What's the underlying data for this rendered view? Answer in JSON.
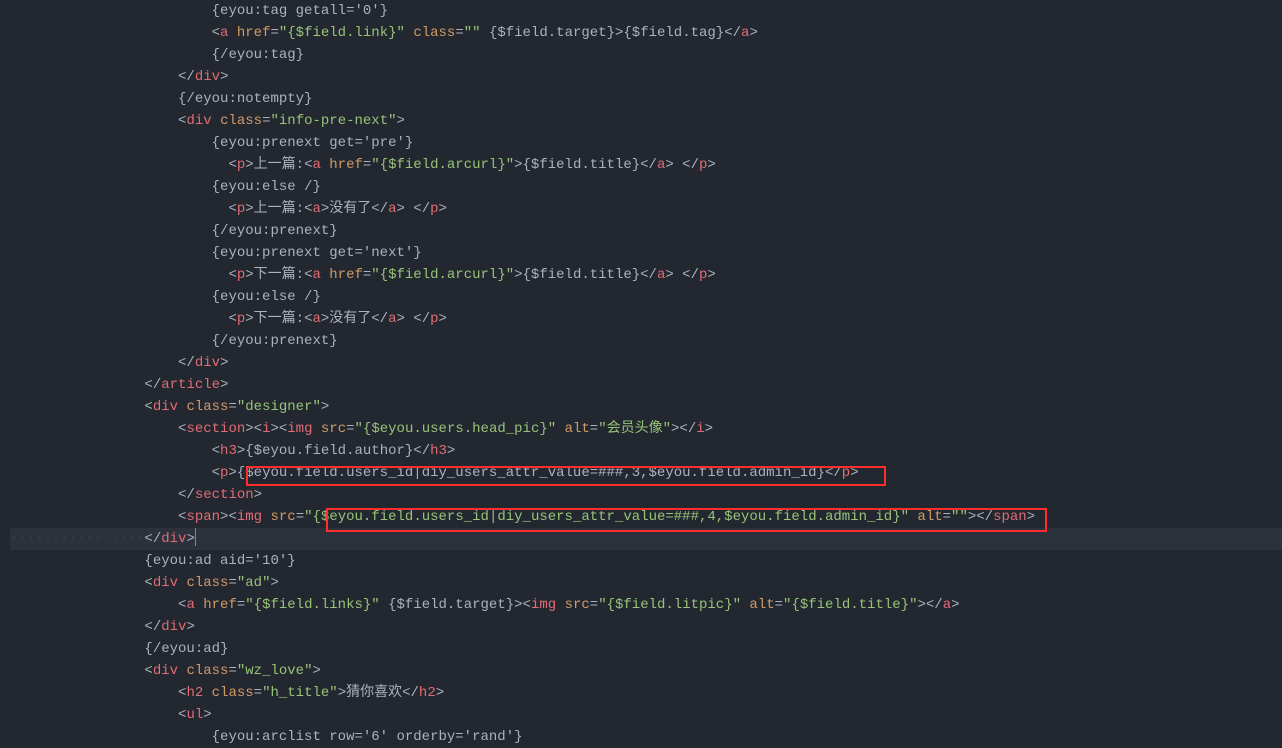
{
  "lines": [
    {
      "indent": 24,
      "segs": [
        {
          "c": "tx",
          "t": "{eyou:tag getall='0'}"
        }
      ]
    },
    {
      "indent": 24,
      "segs": [
        {
          "c": "b",
          "t": "<"
        },
        {
          "c": "t",
          "t": "a"
        },
        {
          "c": "b",
          "t": " "
        },
        {
          "c": "a",
          "t": "href"
        },
        {
          "c": "b",
          "t": "="
        },
        {
          "c": "s",
          "t": "\"{$field.link}\""
        },
        {
          "c": "b",
          "t": " "
        },
        {
          "c": "a",
          "t": "class"
        },
        {
          "c": "b",
          "t": "="
        },
        {
          "c": "s",
          "t": "\"\""
        },
        {
          "c": "b",
          "t": " "
        },
        {
          "c": "tx",
          "t": "{$field.target}"
        },
        {
          "c": "b",
          "t": ">"
        },
        {
          "c": "tx",
          "t": "{$field.tag}"
        },
        {
          "c": "b",
          "t": "</"
        },
        {
          "c": "t",
          "t": "a"
        },
        {
          "c": "b",
          "t": ">"
        }
      ]
    },
    {
      "indent": 24,
      "segs": [
        {
          "c": "tx",
          "t": "{/eyou:tag}"
        }
      ]
    },
    {
      "indent": 20,
      "segs": [
        {
          "c": "b",
          "t": "</"
        },
        {
          "c": "t",
          "t": "div"
        },
        {
          "c": "b",
          "t": ">"
        }
      ]
    },
    {
      "indent": 20,
      "segs": [
        {
          "c": "tx",
          "t": "{/eyou:notempty}"
        }
      ]
    },
    {
      "indent": 20,
      "segs": [
        {
          "c": "b",
          "t": "<"
        },
        {
          "c": "t",
          "t": "div"
        },
        {
          "c": "b",
          "t": " "
        },
        {
          "c": "a",
          "t": "class"
        },
        {
          "c": "b",
          "t": "="
        },
        {
          "c": "s",
          "t": "\"info-pre-next\""
        },
        {
          "c": "b",
          "t": ">"
        }
      ]
    },
    {
      "indent": 24,
      "segs": [
        {
          "c": "tx",
          "t": "{eyou:prenext get='pre'}"
        }
      ]
    },
    {
      "indent": 26,
      "segs": [
        {
          "c": "b",
          "t": "<"
        },
        {
          "c": "t",
          "t": "p"
        },
        {
          "c": "b",
          "t": ">"
        },
        {
          "c": "tx",
          "t": "上一篇:"
        },
        {
          "c": "b",
          "t": "<"
        },
        {
          "c": "t",
          "t": "a"
        },
        {
          "c": "b",
          "t": " "
        },
        {
          "c": "a",
          "t": "href"
        },
        {
          "c": "b",
          "t": "="
        },
        {
          "c": "s",
          "t": "\"{$field.arcurl}\""
        },
        {
          "c": "b",
          "t": ">"
        },
        {
          "c": "tx",
          "t": "{$field.title}"
        },
        {
          "c": "b",
          "t": "</"
        },
        {
          "c": "t",
          "t": "a"
        },
        {
          "c": "b",
          "t": "> </"
        },
        {
          "c": "t",
          "t": "p"
        },
        {
          "c": "b",
          "t": ">"
        }
      ]
    },
    {
      "indent": 24,
      "segs": [
        {
          "c": "tx",
          "t": "{eyou:else /}"
        }
      ]
    },
    {
      "indent": 26,
      "segs": [
        {
          "c": "b",
          "t": "<"
        },
        {
          "c": "t",
          "t": "p"
        },
        {
          "c": "b",
          "t": ">"
        },
        {
          "c": "tx",
          "t": "上一篇:"
        },
        {
          "c": "b",
          "t": "<"
        },
        {
          "c": "t",
          "t": "a"
        },
        {
          "c": "b",
          "t": ">"
        },
        {
          "c": "tx",
          "t": "没有了"
        },
        {
          "c": "b",
          "t": "</"
        },
        {
          "c": "t",
          "t": "a"
        },
        {
          "c": "b",
          "t": "> </"
        },
        {
          "c": "t",
          "t": "p"
        },
        {
          "c": "b",
          "t": ">"
        }
      ]
    },
    {
      "indent": 24,
      "segs": [
        {
          "c": "tx",
          "t": "{/eyou:prenext}"
        }
      ]
    },
    {
      "indent": 24,
      "segs": [
        {
          "c": "tx",
          "t": "{eyou:prenext get='next'}"
        }
      ]
    },
    {
      "indent": 26,
      "segs": [
        {
          "c": "b",
          "t": "<"
        },
        {
          "c": "t",
          "t": "p"
        },
        {
          "c": "b",
          "t": ">"
        },
        {
          "c": "tx",
          "t": "下一篇:"
        },
        {
          "c": "b",
          "t": "<"
        },
        {
          "c": "t",
          "t": "a"
        },
        {
          "c": "b",
          "t": " "
        },
        {
          "c": "a",
          "t": "href"
        },
        {
          "c": "b",
          "t": "="
        },
        {
          "c": "s",
          "t": "\"{$field.arcurl}\""
        },
        {
          "c": "b",
          "t": ">"
        },
        {
          "c": "tx",
          "t": "{$field.title}"
        },
        {
          "c": "b",
          "t": "</"
        },
        {
          "c": "t",
          "t": "a"
        },
        {
          "c": "b",
          "t": "> </"
        },
        {
          "c": "t",
          "t": "p"
        },
        {
          "c": "b",
          "t": ">"
        }
      ]
    },
    {
      "indent": 24,
      "segs": [
        {
          "c": "tx",
          "t": "{eyou:else /}"
        }
      ]
    },
    {
      "indent": 26,
      "segs": [
        {
          "c": "b",
          "t": "<"
        },
        {
          "c": "t",
          "t": "p"
        },
        {
          "c": "b",
          "t": ">"
        },
        {
          "c": "tx",
          "t": "下一篇:"
        },
        {
          "c": "b",
          "t": "<"
        },
        {
          "c": "t",
          "t": "a"
        },
        {
          "c": "b",
          "t": ">"
        },
        {
          "c": "tx",
          "t": "没有了"
        },
        {
          "c": "b",
          "t": "</"
        },
        {
          "c": "t",
          "t": "a"
        },
        {
          "c": "b",
          "t": "> </"
        },
        {
          "c": "t",
          "t": "p"
        },
        {
          "c": "b",
          "t": ">"
        }
      ]
    },
    {
      "indent": 24,
      "segs": [
        {
          "c": "tx",
          "t": "{/eyou:prenext}"
        }
      ]
    },
    {
      "indent": 20,
      "segs": [
        {
          "c": "b",
          "t": "</"
        },
        {
          "c": "t",
          "t": "div"
        },
        {
          "c": "b",
          "t": ">"
        }
      ]
    },
    {
      "indent": 16,
      "segs": [
        {
          "c": "b",
          "t": "</"
        },
        {
          "c": "t",
          "t": "article"
        },
        {
          "c": "b",
          "t": ">"
        }
      ]
    },
    {
      "indent": 16,
      "segs": [
        {
          "c": "b",
          "t": "<"
        },
        {
          "c": "t",
          "t": "div"
        },
        {
          "c": "b",
          "t": " "
        },
        {
          "c": "a",
          "t": "class"
        },
        {
          "c": "b",
          "t": "="
        },
        {
          "c": "s",
          "t": "\"designer\""
        },
        {
          "c": "b",
          "t": ">"
        }
      ]
    },
    {
      "indent": 20,
      "segs": [
        {
          "c": "b",
          "t": "<"
        },
        {
          "c": "t",
          "t": "section"
        },
        {
          "c": "b",
          "t": "><"
        },
        {
          "c": "t",
          "t": "i"
        },
        {
          "c": "b",
          "t": "><"
        },
        {
          "c": "t",
          "t": "img"
        },
        {
          "c": "b",
          "t": " "
        },
        {
          "c": "a",
          "t": "src"
        },
        {
          "c": "b",
          "t": "="
        },
        {
          "c": "s",
          "t": "\"{$eyou.users.head_pic}\""
        },
        {
          "c": "b",
          "t": " "
        },
        {
          "c": "a",
          "t": "alt"
        },
        {
          "c": "b",
          "t": "="
        },
        {
          "c": "s",
          "t": "\"会员头像\""
        },
        {
          "c": "b",
          "t": "></"
        },
        {
          "c": "t",
          "t": "i"
        },
        {
          "c": "b",
          "t": ">"
        }
      ]
    },
    {
      "indent": 24,
      "segs": [
        {
          "c": "b",
          "t": "<"
        },
        {
          "c": "t",
          "t": "h3"
        },
        {
          "c": "b",
          "t": ">"
        },
        {
          "c": "tx",
          "t": "{$eyou.field.author}"
        },
        {
          "c": "b",
          "t": "</"
        },
        {
          "c": "t",
          "t": "h3"
        },
        {
          "c": "b",
          "t": ">"
        }
      ]
    },
    {
      "indent": 24,
      "segs": [
        {
          "c": "b",
          "t": "<"
        },
        {
          "c": "t",
          "t": "p"
        },
        {
          "c": "b",
          "t": ">"
        },
        {
          "c": "tx",
          "t": "{$eyou.field.users_id|diy_users_attr_value=###,3,$eyou.field.admin_id}"
        },
        {
          "c": "b",
          "t": "</"
        },
        {
          "c": "t",
          "t": "p"
        },
        {
          "c": "b",
          "t": ">"
        }
      ]
    },
    {
      "indent": 20,
      "segs": [
        {
          "c": "b",
          "t": "</"
        },
        {
          "c": "t",
          "t": "section"
        },
        {
          "c": "b",
          "t": ">"
        }
      ]
    },
    {
      "indent": 20,
      "segs": [
        {
          "c": "b",
          "t": "<"
        },
        {
          "c": "t",
          "t": "span"
        },
        {
          "c": "b",
          "t": "><"
        },
        {
          "c": "t",
          "t": "img"
        },
        {
          "c": "b",
          "t": " "
        },
        {
          "c": "a",
          "t": "src"
        },
        {
          "c": "b",
          "t": "="
        },
        {
          "c": "s",
          "t": "\"{$eyou.field.users_id|diy_users_attr_value=###,4,$eyou.field.admin_id}\""
        },
        {
          "c": "b",
          "t": " "
        },
        {
          "c": "a",
          "t": "alt"
        },
        {
          "c": "b",
          "t": "="
        },
        {
          "c": "s",
          "t": "\"\""
        },
        {
          "c": "b",
          "t": "></"
        },
        {
          "c": "t",
          "t": "span"
        },
        {
          "c": "b",
          "t": ">"
        }
      ]
    },
    {
      "indent": 16,
      "hl": true,
      "cursor": true,
      "segs": [
        {
          "c": "b",
          "t": "</"
        },
        {
          "c": "t",
          "t": "div"
        },
        {
          "c": "b",
          "t": ">"
        }
      ]
    },
    {
      "indent": 16,
      "segs": [
        {
          "c": "tx",
          "t": "{eyou:ad aid='10'}"
        }
      ]
    },
    {
      "indent": 16,
      "segs": [
        {
          "c": "b",
          "t": "<"
        },
        {
          "c": "t",
          "t": "div"
        },
        {
          "c": "b",
          "t": " "
        },
        {
          "c": "a",
          "t": "class"
        },
        {
          "c": "b",
          "t": "="
        },
        {
          "c": "s",
          "t": "\"ad\""
        },
        {
          "c": "b",
          "t": ">"
        }
      ]
    },
    {
      "indent": 20,
      "segs": [
        {
          "c": "b",
          "t": "<"
        },
        {
          "c": "t",
          "t": "a"
        },
        {
          "c": "b",
          "t": " "
        },
        {
          "c": "a",
          "t": "href"
        },
        {
          "c": "b",
          "t": "="
        },
        {
          "c": "s",
          "t": "\"{$field.links}\""
        },
        {
          "c": "b",
          "t": " "
        },
        {
          "c": "tx",
          "t": "{$field.target}"
        },
        {
          "c": "b",
          "t": "><"
        },
        {
          "c": "t",
          "t": "img"
        },
        {
          "c": "b",
          "t": " "
        },
        {
          "c": "a",
          "t": "src"
        },
        {
          "c": "b",
          "t": "="
        },
        {
          "c": "s",
          "t": "\"{$field.litpic}\""
        },
        {
          "c": "b",
          "t": " "
        },
        {
          "c": "a",
          "t": "alt"
        },
        {
          "c": "b",
          "t": "="
        },
        {
          "c": "s",
          "t": "\"{$field.title}\""
        },
        {
          "c": "b",
          "t": "></"
        },
        {
          "c": "t",
          "t": "a"
        },
        {
          "c": "b",
          "t": ">"
        }
      ]
    },
    {
      "indent": 16,
      "segs": [
        {
          "c": "b",
          "t": "</"
        },
        {
          "c": "t",
          "t": "div"
        },
        {
          "c": "b",
          "t": ">"
        }
      ]
    },
    {
      "indent": 16,
      "segs": [
        {
          "c": "tx",
          "t": "{/eyou:ad}"
        }
      ]
    },
    {
      "indent": 16,
      "segs": [
        {
          "c": "b",
          "t": "<"
        },
        {
          "c": "t",
          "t": "div"
        },
        {
          "c": "b",
          "t": " "
        },
        {
          "c": "a",
          "t": "class"
        },
        {
          "c": "b",
          "t": "="
        },
        {
          "c": "s",
          "t": "\"wz_love\""
        },
        {
          "c": "b",
          "t": ">"
        }
      ]
    },
    {
      "indent": 20,
      "segs": [
        {
          "c": "b",
          "t": "<"
        },
        {
          "c": "t",
          "t": "h2"
        },
        {
          "c": "b",
          "t": " "
        },
        {
          "c": "a",
          "t": "class"
        },
        {
          "c": "b",
          "t": "="
        },
        {
          "c": "s",
          "t": "\"h_title\""
        },
        {
          "c": "b",
          "t": ">"
        },
        {
          "c": "tx",
          "t": "猜你喜欢"
        },
        {
          "c": "b",
          "t": "</"
        },
        {
          "c": "t",
          "t": "h2"
        },
        {
          "c": "b",
          "t": ">"
        }
      ]
    },
    {
      "indent": 20,
      "segs": [
        {
          "c": "b",
          "t": "<"
        },
        {
          "c": "t",
          "t": "ul"
        },
        {
          "c": "b",
          "t": ">"
        }
      ]
    },
    {
      "indent": 24,
      "segs": [
        {
          "c": "tx",
          "t": "{eyou:arclist row='6' orderby='rand'}"
        }
      ]
    }
  ]
}
